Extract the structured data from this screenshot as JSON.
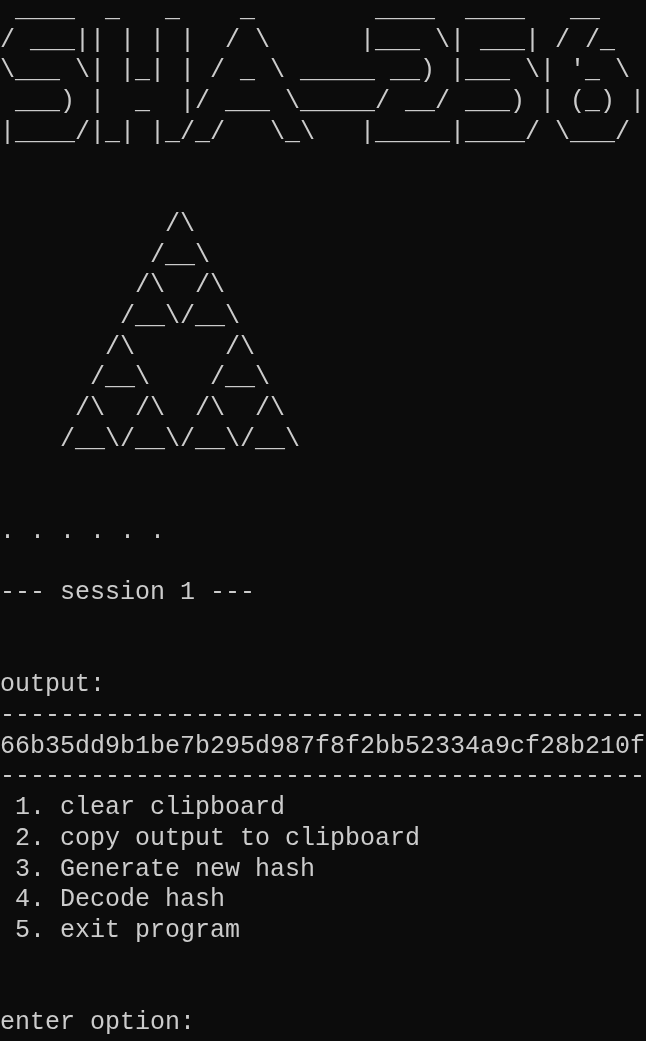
{
  "banner": [
    " ____  _   _    _        ____  ____   __",
    "/ ___|| | | |  / \\      |___ \\| ___| / /_",
    "\\___ \\| |_| | / _ \\ _____ __) |___ \\| '_ \\",
    " ___) |  _  |/ ___ \\_____/ __/ ___) | (_) |",
    "|____/|_| |_/_/   \\_\\   |_____|____/ \\___/"
  ],
  "triangle": [
    "           /\\",
    "          /__\\",
    "         /\\  /\\",
    "        /__\\/__\\",
    "       /\\      /\\",
    "      /__\\    /__\\",
    "     /\\  /\\  /\\  /\\",
    "    /__\\/__\\/__\\/__\\"
  ],
  "progress": ". . . . . .",
  "session": "--- session 1 ---",
  "output": {
    "label": "output:",
    "rule_top": "-------------------------------------------",
    "hash": "66b35dd9b1be7b295d987f8f2bb52334a9cf28b210f",
    "rule_bottom": "-------------------------------------------"
  },
  "menu": [
    " 1. clear clipboard",
    " 2. copy output to clipboard",
    " 3. Generate new hash",
    " 4. Decode hash",
    " 5. exit program"
  ],
  "prompt": "enter option:"
}
